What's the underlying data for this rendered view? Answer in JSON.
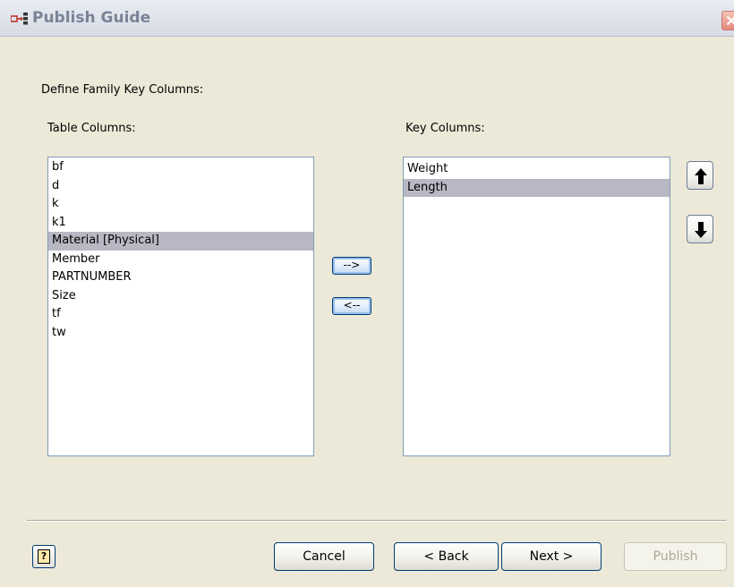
{
  "window": {
    "title": "Publish Guide",
    "icon": "publish-guide-icon",
    "close_icon": "close-icon"
  },
  "section_label": "Define Family Key Columns:",
  "table_columns": {
    "label": "Table Columns:",
    "items": [
      "bf",
      "d",
      "k",
      "k1",
      "Material [Physical]",
      "Member",
      "PARTNUMBER",
      "Size",
      "tf",
      "tw"
    ],
    "selected": "Material [Physical]"
  },
  "key_columns": {
    "label": "Key Columns:",
    "items": [
      "Weight",
      "Length"
    ],
    "selected": "Length"
  },
  "transfer": {
    "add_label": "-->",
    "remove_label": "<--"
  },
  "order": {
    "up_icon": "arrow-up-icon",
    "down_icon": "arrow-down-icon"
  },
  "footer": {
    "help_icon": "help-icon",
    "cancel_label": "Cancel",
    "back_label": "< Back",
    "next_label": "Next >",
    "publish_label": "Publish"
  },
  "colors": {
    "dialog_bg": "#ece9d8",
    "selection": "#b8b8c4",
    "list_border": "#7f9db9",
    "title_text": "#7a8396",
    "button_border": "#003c74"
  }
}
